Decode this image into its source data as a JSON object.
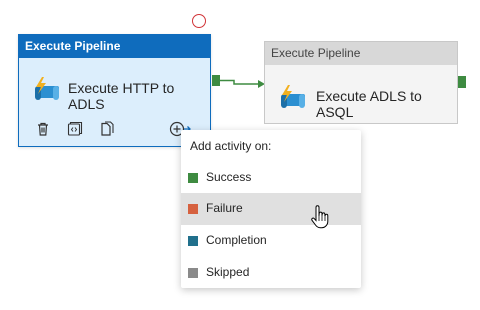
{
  "activities": [
    {
      "header": "Execute Pipeline",
      "name": "Execute HTTP to ADLS",
      "state": "selected"
    },
    {
      "header": "Execute Pipeline",
      "name": "Execute ADLS to ASQL",
      "state": "default"
    }
  ],
  "toolbar_icons": [
    "trash-icon",
    "code-icon",
    "copy-icon",
    "add-output-icon"
  ],
  "context_menu": {
    "title": "Add activity on:",
    "items": [
      {
        "label": "Success",
        "color": "#3e8b41"
      },
      {
        "label": "Failure",
        "color": "#d6613f"
      },
      {
        "label": "Completion",
        "color": "#21708c"
      },
      {
        "label": "Skipped",
        "color": "#8a8a8a"
      }
    ],
    "hovered": "Failure"
  },
  "colors": {
    "accent": "#0f6cbd",
    "selected_bg": "#dceefc",
    "success": "#3e8b41"
  }
}
